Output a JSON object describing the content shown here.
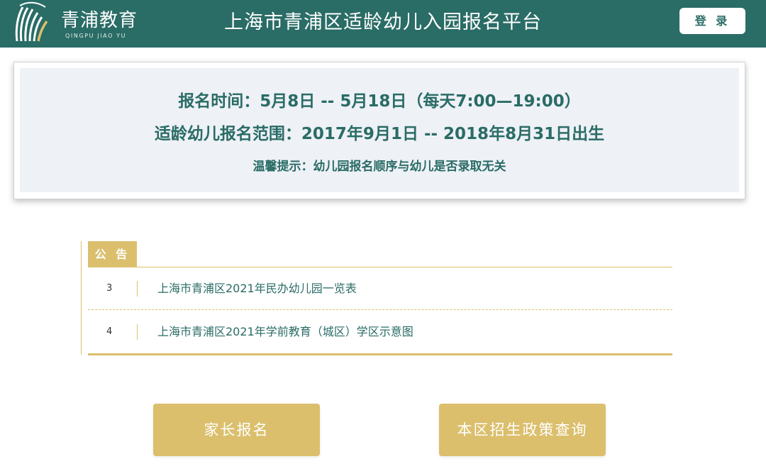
{
  "header": {
    "logo_cn": "青浦教育",
    "logo_en": "QINGPU JIAO YU",
    "title": "上海市青浦区适龄幼儿入园报名平台",
    "login_label": "登 录"
  },
  "info": {
    "line1": "报名时间：5月8日 -- 5月18日（每天7:00—19:00）",
    "line2": "适龄幼儿报名范围：2017年9月1日 -- 2018年8月31日出生",
    "line3": "温馨提示：幼儿园报名顺序与幼儿是否录取无关"
  },
  "notice": {
    "tab_label": "公 告",
    "items": [
      {
        "num": "3",
        "text": "上海市青浦区2021年民办幼儿园一览表"
      },
      {
        "num": "4",
        "text": "上海市青浦区2021年学前教育（城区）学区示意图"
      }
    ]
  },
  "actions": {
    "register_label": "家长报名",
    "policy_label": "本区招生政策查询"
  },
  "colors": {
    "header_bg": "#2a6c66",
    "accent_gold": "#dbbf6c",
    "panel_bg": "#eef1f6"
  }
}
